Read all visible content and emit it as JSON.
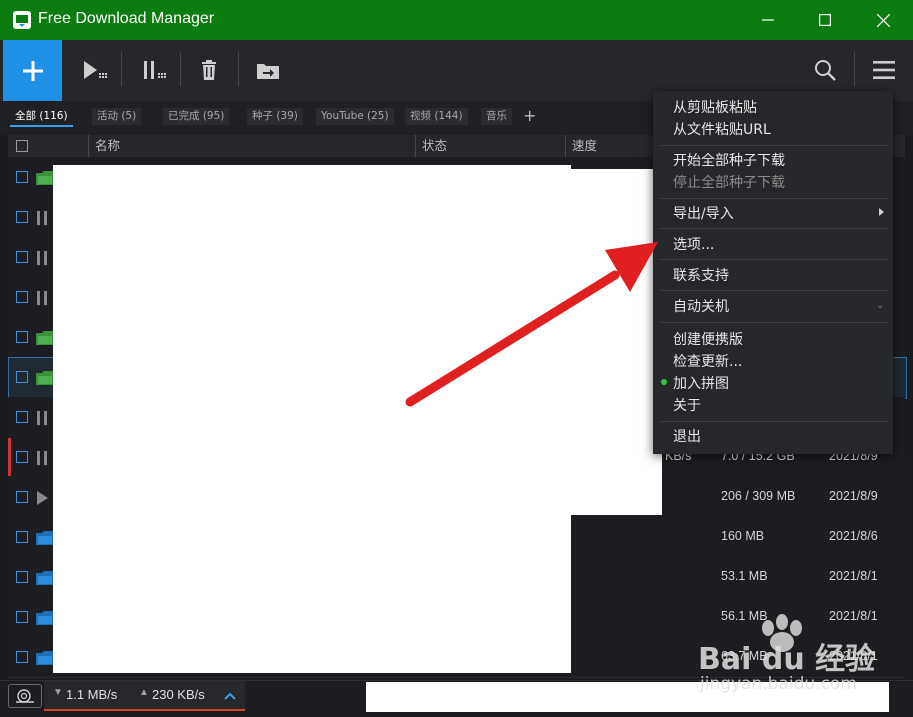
{
  "window": {
    "title": "Free Download Manager"
  },
  "filter_tabs": [
    {
      "label": "全部 (116)",
      "active": true
    },
    {
      "label": "活动 (5)"
    },
    {
      "label": "已完成 (95)"
    },
    {
      "label": "种子 (39)"
    },
    {
      "label": "YouTube (25)"
    },
    {
      "label": "视频 (144)"
    },
    {
      "label": "音乐"
    }
  ],
  "add_tab_glyph": "+",
  "columns": {
    "name": "名称",
    "status": "状态",
    "speed": "速度"
  },
  "rows": [
    {
      "icon": "folder-green",
      "speed": "",
      "size": "",
      "date": ""
    },
    {
      "icon": "pause",
      "speed": "",
      "size": "",
      "date": ""
    },
    {
      "icon": "pause",
      "speed": "",
      "size": "",
      "date": ""
    },
    {
      "icon": "pause",
      "speed": "",
      "size": "",
      "date": ""
    },
    {
      "icon": "folder-green",
      "speed": "",
      "size": "",
      "date": ""
    },
    {
      "icon": "folder-green",
      "speed": "",
      "size": "",
      "date": "",
      "selected": true
    },
    {
      "icon": "pause",
      "speed": "",
      "size": "",
      "date": ""
    },
    {
      "icon": "pause",
      "speed": "KB/s",
      "size": "7.0 / 15.2 GB",
      "date": "2021/8/9"
    },
    {
      "icon": "play",
      "speed": "",
      "size": "206 / 309 MB",
      "date": "2021/8/9"
    },
    {
      "icon": "folder-blue",
      "speed": "",
      "size": "160 MB",
      "date": "2021/8/6"
    },
    {
      "icon": "folder-blue",
      "speed": "",
      "size": "53.1 MB",
      "date": "2021/8/1"
    },
    {
      "icon": "folder-blue",
      "speed": "",
      "size": "56.1 MB",
      "date": "2021/8/1"
    },
    {
      "icon": "folder-blue",
      "speed": "",
      "size": "63.7 MB",
      "date": "2021/8/1"
    }
  ],
  "menu": {
    "paste_clipboard": "从剪贴板粘贴",
    "paste_file_url": "从文件粘贴URL",
    "start_all_torrents": "开始全部种子下载",
    "stop_all_torrents": "停止全部种子下载",
    "export_import": "导出/导入",
    "options": "选项...",
    "contact_support": "联系支持",
    "auto_shutdown": "自动关机",
    "create_portable": "创建便携版",
    "check_updates": "检查更新...",
    "join_puzzle": "加入拼图",
    "about": "关于",
    "exit": "退出"
  },
  "status": {
    "down_speed": "1.1 MB/s",
    "up_speed": "230 KB/s"
  },
  "watermark": {
    "brand": "Bai du 经验",
    "url": "jingyan.baidu.com"
  },
  "colors": {
    "titlebar": "#0d7c10",
    "accent": "#1e90e6",
    "arrow": "#e02020"
  }
}
